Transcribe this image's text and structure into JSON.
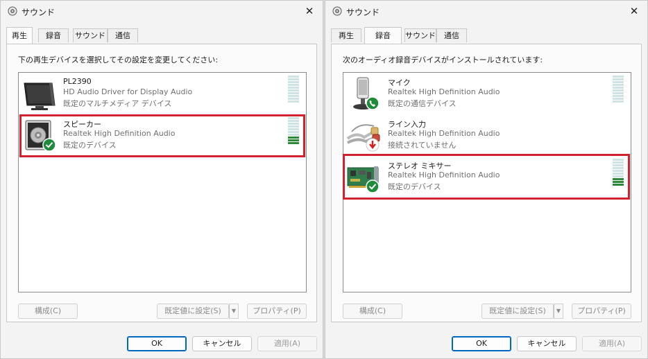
{
  "left": {
    "title": "サウンド",
    "tabs": [
      "再生",
      "録音",
      "サウンド",
      "通信"
    ],
    "active_tab": "再生",
    "instruction": "下の再生デバイスを選択してその設定を変更してください:",
    "devices": [
      {
        "name": "PL2390",
        "driver": "HD Audio Driver for Display Audio",
        "status": "既定のマルチメディア デバイス",
        "icon": "monitor-icon",
        "level": 0
      },
      {
        "name": "スピーカー",
        "driver": "Realtek High Definition Audio",
        "status": "既定のデバイス",
        "icon": "speaker-icon",
        "badge": "check-badge-icon",
        "level": 0.3,
        "highlighted": true
      }
    ],
    "buttons": {
      "configure": "構成(C)",
      "set_default": "既定値に設定(S)",
      "properties": "プロパティ(P)"
    }
  },
  "right": {
    "title": "サウンド",
    "tabs": [
      "再生",
      "録音",
      "サウンド",
      "通信"
    ],
    "active_tab": "録音",
    "instruction": "次のオーディオ録音デバイスがインストールされています:",
    "devices": [
      {
        "name": "マイク",
        "driver": "Realtek High Definition Audio",
        "status": "既定の通信デバイス",
        "icon": "microphone-icon",
        "badge": "phone-badge-icon",
        "level": 0
      },
      {
        "name": "ライン入力",
        "driver": "Realtek High Definition Audio",
        "status": "接続されていません",
        "icon": "line-in-cable-icon",
        "badge": "disconnected-badge-icon",
        "level": 0
      },
      {
        "name": "ステレオ ミキサー",
        "driver": "Realtek High Definition Audio",
        "status": "既定のデバイス",
        "icon": "sound-card-icon",
        "badge": "check-badge-icon",
        "level": 0.3,
        "highlighted": true
      }
    ],
    "buttons": {
      "configure": "構成(C)",
      "set_default": "既定値に設定(S)",
      "properties": "プロパティ(P)"
    }
  },
  "footer": {
    "ok": "OK",
    "cancel": "キャンセル",
    "apply": "適用(A)"
  },
  "colors": {
    "highlight": "#d0212c",
    "meter_on": "#2a8a3a",
    "check_badge": "#1e8c3a",
    "ok_border": "#0067c0"
  }
}
